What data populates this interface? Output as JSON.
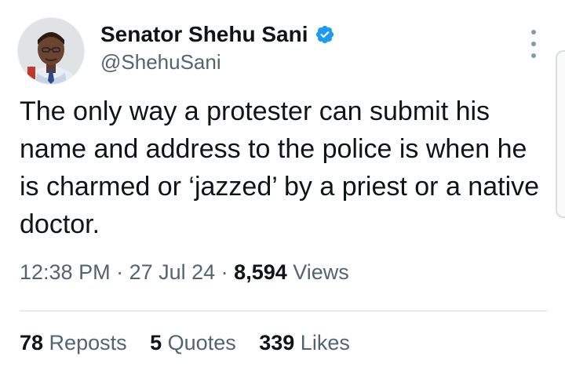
{
  "author": {
    "display_name": "Senator Shehu Sani",
    "handle": "@ShehuSani",
    "verified": true
  },
  "tweet": {
    "text": "The only way a protester can submit his name and address to the police is when he is charmed or ‘jazzed’ by a priest or a native doctor."
  },
  "meta": {
    "time": "12:38 PM",
    "sep1": " · ",
    "date": "27 Jul 24",
    "sep2": " · ",
    "views_count": "8,594",
    "views_label": " Views"
  },
  "stats": {
    "reposts_count": "78",
    "reposts_label": " Reposts",
    "quotes_count": "5",
    "quotes_label": " Quotes",
    "likes_count": "339",
    "likes_label": " Likes"
  },
  "colors": {
    "verified_badge": "#1d9bf0",
    "text_primary": "#0f1419",
    "text_secondary": "#536471"
  },
  "icons": {
    "verified": "verified-badge-icon",
    "more": "more-options-icon"
  }
}
